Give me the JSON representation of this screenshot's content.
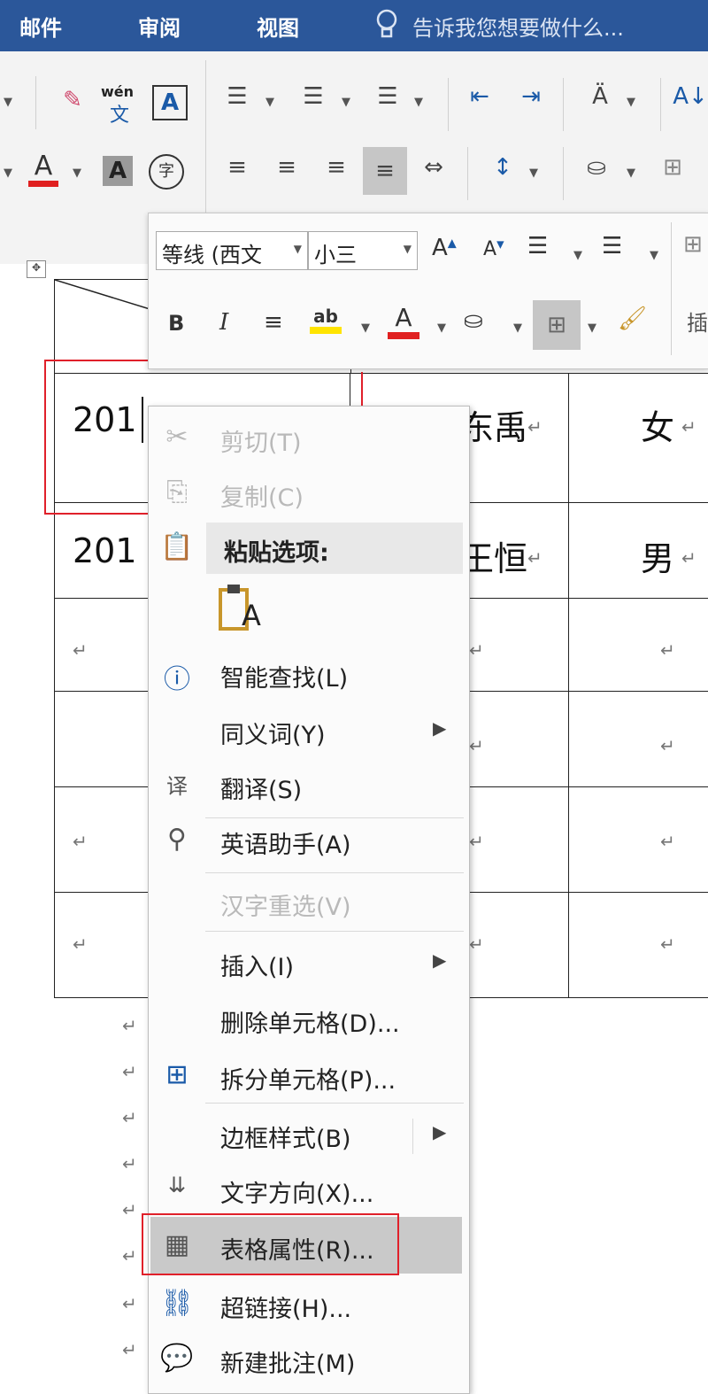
{
  "titlebar": {
    "tabs": [
      "邮件",
      "审阅",
      "视图"
    ],
    "tell_me": "告诉我您想要做什么..."
  },
  "ribbon": {
    "pinyin_label": "wén",
    "pinyin_char": "文",
    "char_border": "A",
    "font_color_glyph": "A",
    "char_shading_glyph": "A",
    "enclose_char": "字"
  },
  "mini_toolbar": {
    "font_name": "等线 (西文",
    "font_size": "小三",
    "bold": "B",
    "italic": "I",
    "insert_label": "插"
  },
  "table": {
    "rows": [
      {
        "col1": "201",
        "col2": "东禹",
        "col3": "女"
      },
      {
        "col1": "201",
        "col2": "王恒",
        "col3": "男"
      }
    ]
  },
  "context_menu": {
    "items": [
      {
        "label": "剪切(T)",
        "icon": "scissors-icon",
        "disabled": true
      },
      {
        "label": "复制(C)",
        "icon": "copy-icon",
        "disabled": true
      },
      {
        "label": "粘贴选项:",
        "icon": "paste-icon",
        "disabled": false
      },
      {
        "label": "智能查找(L)",
        "icon": "smart-lookup-icon",
        "disabled": false
      },
      {
        "label": "同义词(Y)",
        "icon": "",
        "disabled": false,
        "submenu": true
      },
      {
        "label": "翻译(S)",
        "icon": "translate-icon",
        "disabled": false
      },
      {
        "label": "英语助手(A)",
        "icon": "english-assistant-icon",
        "disabled": false
      },
      {
        "label": "汉字重选(V)",
        "icon": "",
        "disabled": true
      },
      {
        "label": "插入(I)",
        "icon": "",
        "disabled": false,
        "submenu": true
      },
      {
        "label": "删除单元格(D)...",
        "icon": "",
        "disabled": false
      },
      {
        "label": "拆分单元格(P)...",
        "icon": "split-cells-icon",
        "disabled": false
      },
      {
        "label": "边框样式(B)",
        "icon": "",
        "disabled": false,
        "submenu": true
      },
      {
        "label": "文字方向(X)...",
        "icon": "text-direction-icon",
        "disabled": false
      },
      {
        "label": "表格属性(R)...",
        "icon": "table-properties-icon",
        "disabled": false,
        "highlighted": true
      },
      {
        "label": "超链接(H)...",
        "icon": "hyperlink-icon",
        "disabled": false
      },
      {
        "label": "新建批注(M)",
        "icon": "new-comment-icon",
        "disabled": false
      }
    ],
    "paste_keep_text": "A"
  },
  "colors": {
    "title_bar": "#2b579a",
    "highlight_red": "#e0202a",
    "font_red": "#e02020",
    "highlight_yellow": "#ffe400"
  }
}
